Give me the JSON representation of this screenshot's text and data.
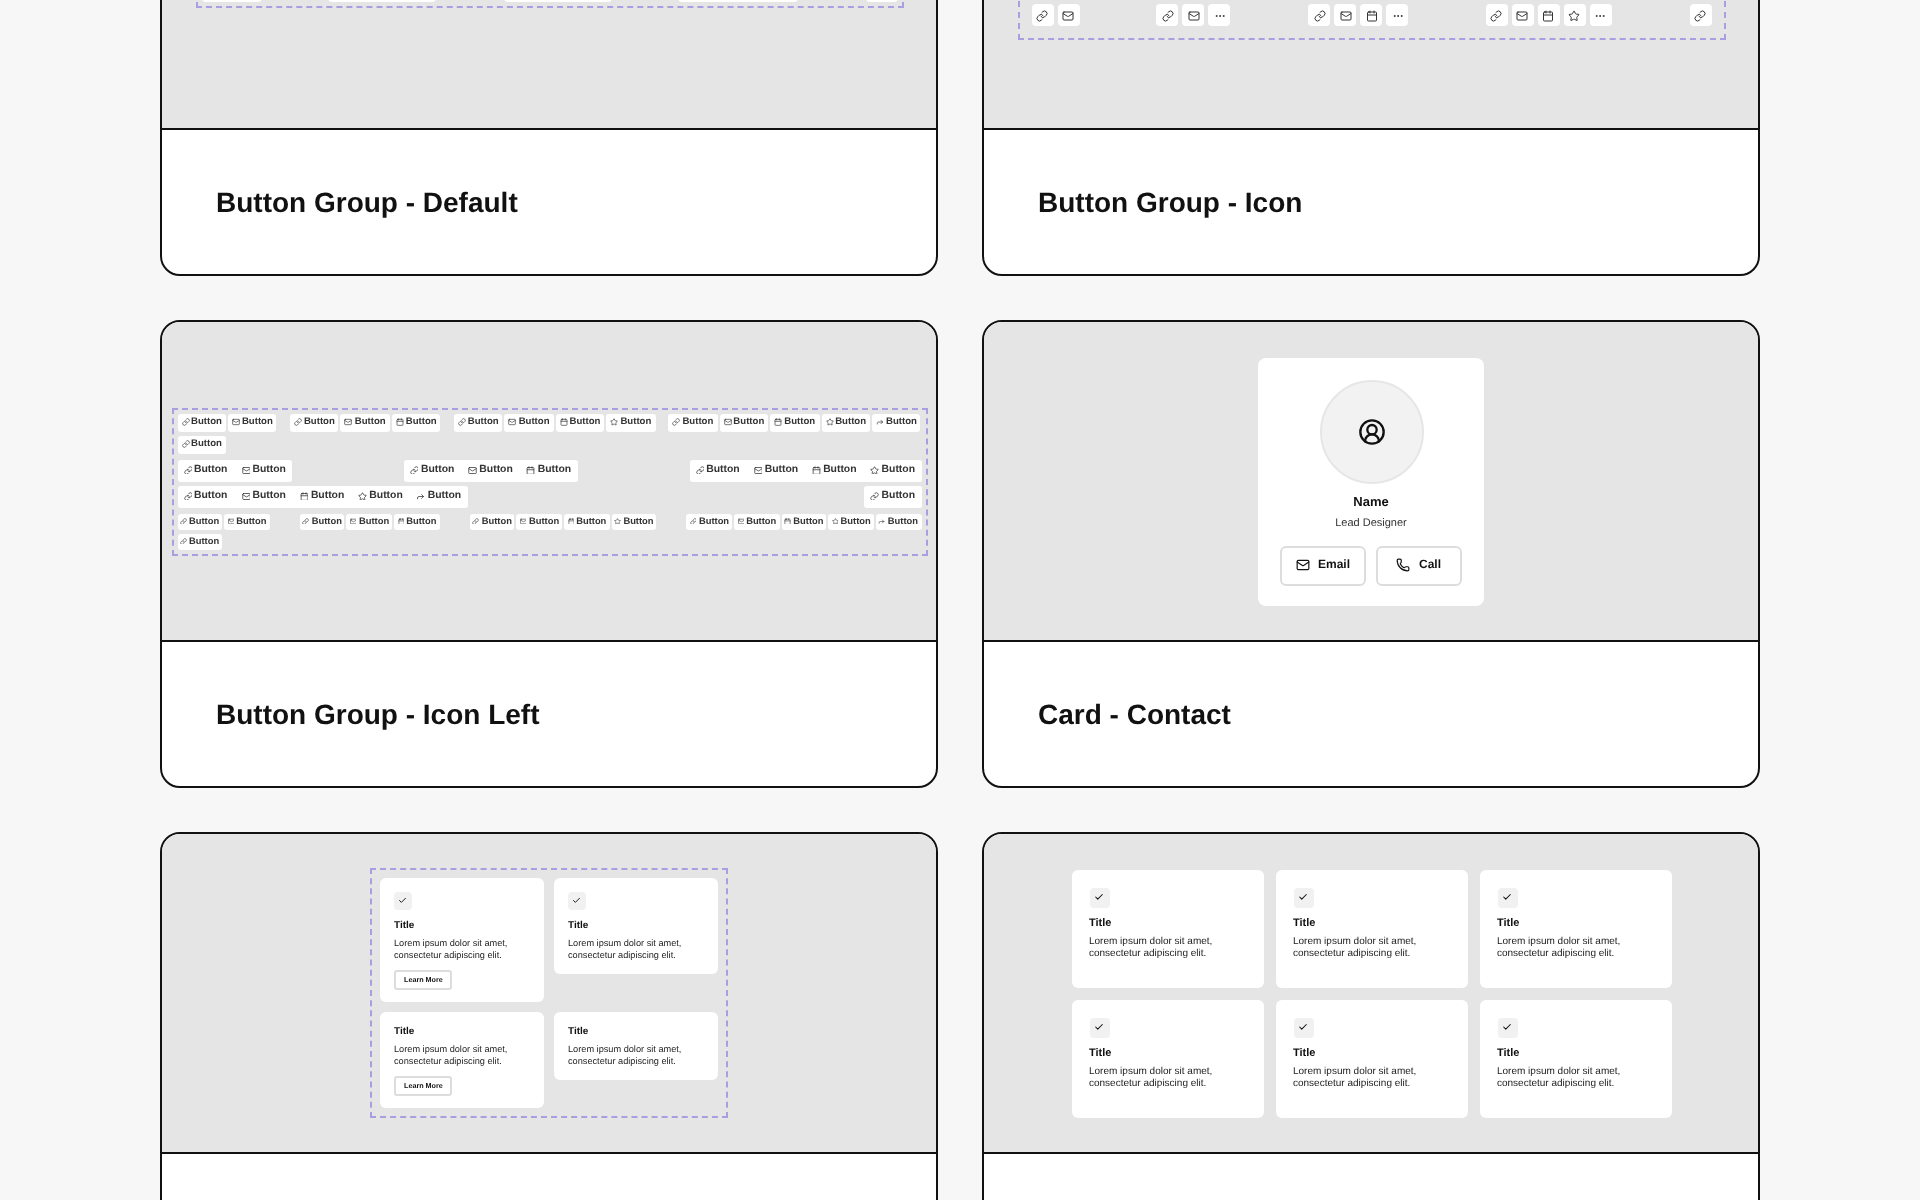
{
  "cards": [
    {
      "kind": "button_group_default",
      "title": "Button Group - Default"
    },
    {
      "kind": "button_group_icon",
      "title": "Button Group - Icon",
      "groups": [
        [
          {
            "kind": "link"
          },
          {
            "kind": "mail"
          }
        ],
        [
          {
            "kind": "link"
          },
          {
            "kind": "mail"
          },
          {
            "kind": "more"
          }
        ],
        [
          {
            "kind": "link"
          },
          {
            "kind": "mail"
          },
          {
            "kind": "calendar"
          },
          {
            "kind": "more"
          }
        ],
        [
          {
            "kind": "link"
          },
          {
            "kind": "mail"
          },
          {
            "kind": "calendar"
          },
          {
            "kind": "star"
          },
          {
            "kind": "more"
          }
        ],
        [
          {
            "kind": "link"
          }
        ]
      ]
    },
    {
      "kind": "button_group_icon_left",
      "title": "Button Group - Icon Left",
      "rows": [
        {
          "kind": "small",
          "groups": [
            [
              "Button",
              "Button"
            ],
            [
              "Button",
              "Button",
              "Button"
            ],
            [
              "Button",
              "Button",
              "Button",
              "Button"
            ],
            [
              "Button",
              "Button",
              "Button",
              "Button",
              "Button"
            ],
            [
              "Button"
            ]
          ]
        },
        {
          "kind": "medium",
          "groups": [
            [
              "Button",
              "Button"
            ],
            [
              "Button",
              "Button",
              "Button"
            ],
            [
              "Button",
              "Button",
              "Button",
              "Button"
            ],
            [
              "Button",
              "Button",
              "Button",
              "Button",
              "Button"
            ],
            [
              "Button"
            ]
          ]
        },
        {
          "kind": "tiny",
          "groups": [
            [
              "Button",
              "Button"
            ],
            [
              "Button",
              "Button",
              "Button"
            ],
            [
              "Button",
              "Button",
              "Button",
              "Button"
            ],
            [
              "Button",
              "Button",
              "Button",
              "Button",
              "Button"
            ],
            [
              "Button"
            ]
          ]
        }
      ]
    },
    {
      "kind": "card_contact",
      "title": "Card - Contact",
      "name": "Name",
      "role": "Lead Designer",
      "buttons": [
        {
          "label": "Email"
        },
        {
          "label": "Call"
        }
      ]
    },
    {
      "kind": "feature_grid",
      "items": [
        {
          "checked": true,
          "title": "Title",
          "text": "Lorem ipsum dolor sit amet, consectetur adipiscing elit.",
          "button": "Learn More"
        },
        {
          "checked": true,
          "title": "Title",
          "text": "Lorem ipsum dolor sit amet, consectetur adipiscing elit."
        },
        {
          "checked": false,
          "title": "Title",
          "text": "Lorem ipsum dolor sit amet, consectetur adipiscing elit.",
          "button": "Learn More"
        },
        {
          "checked": false,
          "title": "Title",
          "text": "Lorem ipsum dolor sit amet, consectetur adipiscing elit."
        }
      ]
    },
    {
      "kind": "feature_grid_large",
      "items": [
        {
          "checked": true,
          "title": "Title",
          "text": "Lorem ipsum dolor sit amet, consectetur adipiscing elit."
        },
        {
          "checked": true,
          "title": "Title",
          "text": "Lorem ipsum dolor sit amet, consectetur adipiscing elit."
        },
        {
          "checked": true,
          "title": "Title",
          "text": "Lorem ipsum dolor sit amet, consectetur adipiscing elit."
        },
        {
          "checked": true,
          "title": "Title",
          "text": "Lorem ipsum dolor sit amet, consectetur adipiscing elit."
        },
        {
          "checked": true,
          "title": "Title",
          "text": "Lorem ipsum dolor sit amet, consectetur adipiscing elit."
        },
        {
          "checked": true,
          "title": "Title",
          "text": "Lorem ipsum dolor sit amet, consectetur adipiscing elit."
        }
      ]
    }
  ]
}
